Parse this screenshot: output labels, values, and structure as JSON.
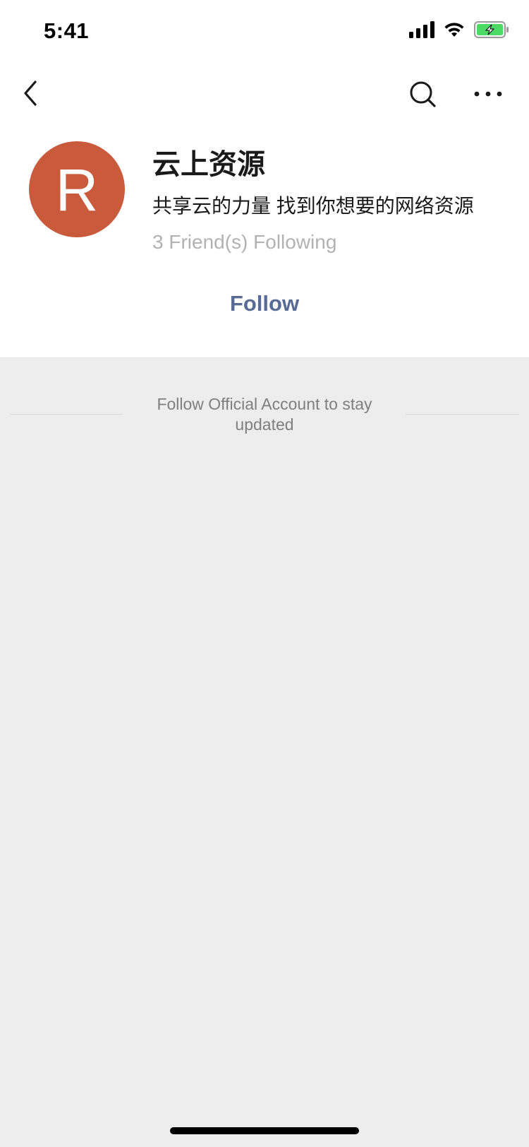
{
  "status_bar": {
    "time": "5:41"
  },
  "navigation": {
    "back_icon": "chevron-left",
    "search_icon": "search",
    "more_icon": "more-horizontal"
  },
  "profile": {
    "avatar_letter": "R",
    "avatar_color": "#c95a3c",
    "name": "云上资源",
    "description": "共享云的力量 找到你想要的网络资源",
    "friends_following": "3 Friend(s) Following",
    "follow_label": "Follow"
  },
  "feed": {
    "hint": "Follow Official Account to stay updated"
  },
  "colors": {
    "accent": "#576b95",
    "background": "#ededed",
    "battery_green": "#4cd964"
  }
}
